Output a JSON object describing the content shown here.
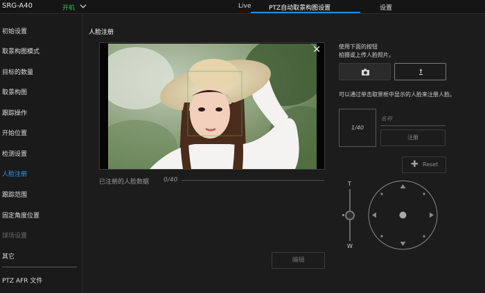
{
  "header": {
    "model": "SRG-A40",
    "power": "开机",
    "tabs": [
      "Live",
      "PTZ自动取景构图设置",
      "设置"
    ]
  },
  "sidebar": {
    "items": [
      {
        "label": "初始设置",
        "state": "normal"
      },
      {
        "label": "取景构图模式",
        "state": "normal"
      },
      {
        "label": "目标的数量",
        "state": "normal"
      },
      {
        "label": "取景构图",
        "state": "normal"
      },
      {
        "label": "跟踪操作",
        "state": "normal"
      },
      {
        "label": "开始位置",
        "state": "normal"
      },
      {
        "label": "检测设置",
        "state": "normal"
      },
      {
        "label": "人脸注册",
        "state": "active"
      },
      {
        "label": "跟踪范围",
        "state": "normal"
      },
      {
        "label": "固定角度位置",
        "state": "normal"
      },
      {
        "label": "球场设置",
        "state": "disabled"
      },
      {
        "label": "其它",
        "state": "normal"
      }
    ],
    "footer": "PTZ AFR 文件"
  },
  "main": {
    "title": "人脸注册",
    "registered_label": "已注册的人脸数据",
    "registered_count": "0/40",
    "edit_button": "编辑"
  },
  "panel": {
    "hint_line1": "使用下面的按钮",
    "hint_line2": "拍摄或上传人脸照片。",
    "hint_select": "可以通过单击取景框中显示的人脸来注册人脸。",
    "slot_count": "1/40",
    "name_placeholder": "名称",
    "register_button": "注册",
    "reset_button": "Reset",
    "zoom_tele": "T",
    "zoom_wide": "W"
  },
  "colors": {
    "accent": "#1e90e0",
    "active_text": "#2a9df4",
    "power_on": "#39c25a",
    "background": "#1c1c1c"
  },
  "icons": [
    "chevron-down-icon",
    "close-icon",
    "camera-icon",
    "upload-icon",
    "plus-icon",
    "ptz-pad-icon"
  ]
}
